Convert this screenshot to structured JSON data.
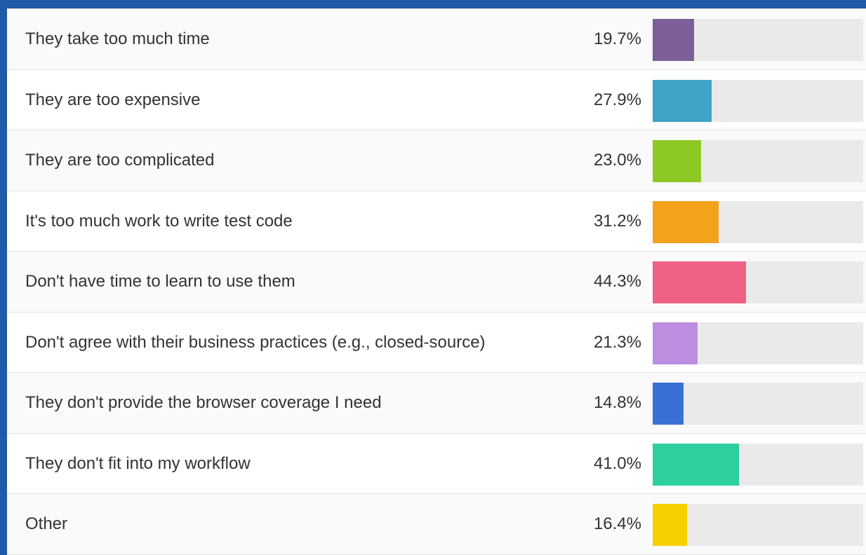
{
  "chart_data": {
    "type": "bar",
    "orientation": "horizontal",
    "scale_max_percent": 100,
    "categories": [
      "They take too much time",
      "They are too expensive",
      "They are too complicated",
      "It's too much work to write test code",
      "Don't have time to learn to use them",
      "Don't agree with their business practices (e.g., closed-source)",
      "They don't provide the browser coverage I need",
      "They don't fit into my workflow",
      "Other"
    ],
    "values": [
      19.7,
      27.9,
      23.0,
      31.2,
      44.3,
      21.3,
      14.8,
      41.0,
      16.4
    ],
    "value_labels": [
      "19.7%",
      "27.9%",
      "23.0%",
      "31.2%",
      "44.3%",
      "21.3%",
      "14.8%",
      "41.0%",
      "16.4%"
    ],
    "colors": [
      "#7b5f96",
      "#3ea3c4",
      "#8dc825",
      "#f2a31b",
      "#ef6285",
      "#bc8ee0",
      "#3a6fd6",
      "#2ecf9f",
      "#f7d000"
    ],
    "track_color": "#eaeaea"
  }
}
